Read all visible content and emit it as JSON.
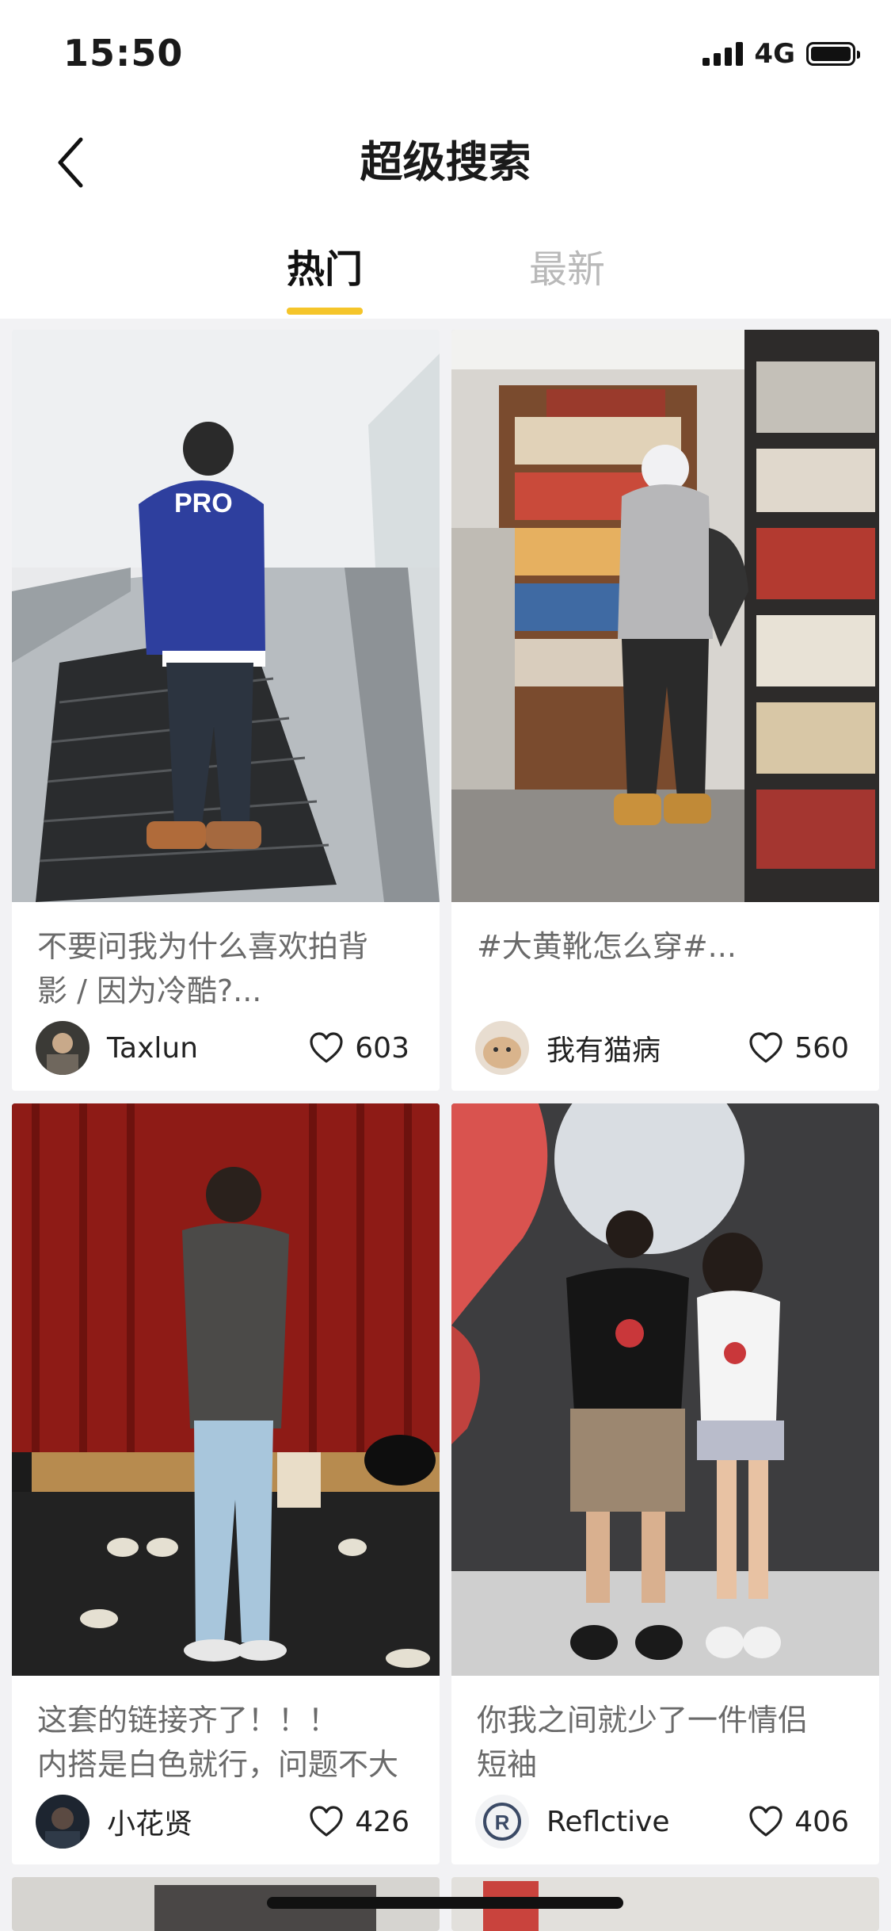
{
  "status": {
    "time": "15:50",
    "network": "4G"
  },
  "nav": {
    "title": "超级搜索",
    "back_icon": "chevron-left-icon"
  },
  "tabs": [
    {
      "label": "热门",
      "active": true
    },
    {
      "label": "最新",
      "active": false
    }
  ],
  "colors": {
    "accent": "#f5c52a",
    "inactive_tab": "#b9b9b9",
    "caption": "#6a6a6a"
  },
  "cards": [
    {
      "text_line1": "不要问我为什么喜欢拍背",
      "text_line2": "影 / 因为冷酷?...",
      "author": "Taxlun",
      "likes": "603"
    },
    {
      "text_line1": "#大黄靴怎么穿#...",
      "text_line2": "",
      "author": "我有猫病",
      "likes": "560"
    },
    {
      "text_line1": "这套的链接齐了！！！",
      "text_line2": "内搭是白色就行，问题不大",
      "author": "小花贤",
      "likes": "426"
    },
    {
      "text_line1": "你我之间就少了一件情侣",
      "text_line2": "短袖",
      "author": "Reflctive",
      "likes": "406"
    }
  ]
}
